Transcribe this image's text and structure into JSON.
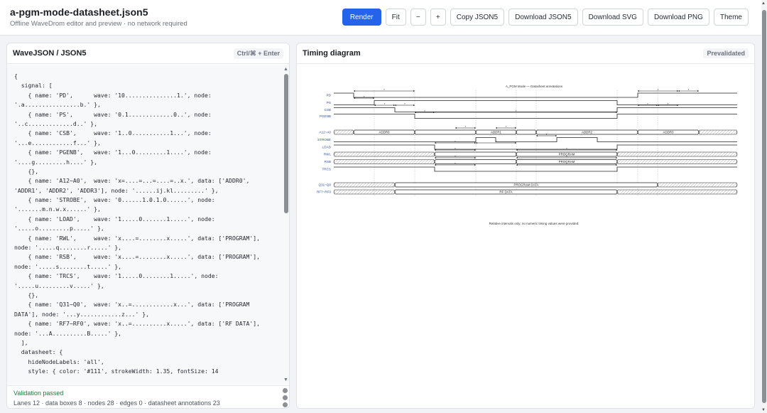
{
  "header": {
    "title": "a-pgm-mode-datasheet.json5",
    "subtitle": "Offline WaveDrom editor and preview · no network required"
  },
  "toolbar": {
    "render": "Render",
    "fit": "Fit",
    "zoom_out": "−",
    "zoom_in": "+",
    "copy_json5": "Copy JSON5",
    "download_json5": "Download JSON5",
    "download_svg": "Download SVG",
    "download_png": "Download PNG",
    "theme": "Theme"
  },
  "editor": {
    "title": "WaveJSON / JSON5",
    "shortcut": "Ctrl/⌘ + Enter",
    "code_lines": [
      "{",
      "  signal: [",
      "    { name: 'PD',      wave: '10...............1.', node:",
      "'.a................b.' },",
      "    { name: 'PS',      wave: '0.1.............0..', node:",
      "'..c.............d..' },",
      "    { name: 'CSB',     wave: '1..0...........1...', node:",
      "'...e............f...' },",
      "    { name: 'PGENB',   wave: '1...0.........1....', node:",
      "'....g.........h....' },",
      "    {},",
      "    { name: 'A12~A0',  wave: 'x=....=...=....=..x.', data: ['ADDR0',",
      "'ADDR1', 'ADDR2', 'ADDR3'], node: '......ij.kl.........' },",
      "    { name: 'STROBE',  wave: '0......1.0.1.0......', node:",
      "'.......m.n.w.x......' },",
      "    { name: 'LOAD',    wave: '1.....0.......1.....', node:",
      "'.....o.........p.....' },",
      "    { name: 'RWL',     wave: 'x....=........x.....', data: ['PROGRAM'],",
      "node: '.....q........r.....' },",
      "    { name: 'RSB',     wave: 'x....=........x.....', data: ['PROGRAM'],",
      "node: '.....s........t.....' },",
      "    { name: 'TRCS',    wave: '1.....0........1.....', node:",
      "'.....u.........v.....' },",
      "    {},",
      "    { name: 'Q31~Q0',  wave: 'x..=............x...', data: ['PROGRAM",
      "DATA'], node: '...y............z...' },",
      "    { name: 'RF7~RF0', wave: 'x..=..........x.....', data: ['RF DATA'],",
      "node: '...A..........B.....' },",
      "  ],",
      "  datasheet: {",
      "    hideNodeLabels: 'all',",
      "    style: { color: '#111', strokeWidth: 1.35, fontSize: 14"
    ]
  },
  "status": {
    "validation": "Validation passed",
    "stats": "Lanes 12 · data boxes 8 · nodes 28 · edges 0 · datasheet annotations 23"
  },
  "preview": {
    "title": "Timing diagram",
    "tag": "Prevalidated"
  },
  "diagram": {
    "title": "A_PGM Mode — Datasheet annotations",
    "note": "Relative intervals only; no numeric timing values were provided.",
    "signals": [
      "PD",
      "PS",
      "CSB",
      "PGENB",
      "A12~A0",
      "STROBE",
      "LOAD",
      "RWL",
      "RSB",
      "TRCS",
      "Q31~Q0",
      "RF7~RF0"
    ],
    "addr_labels": [
      "ADDR0",
      "ADDR1",
      "ADDR2",
      "ADDR3"
    ],
    "rwl_label": "PROGRAM",
    "rsb_label": "PROGRAM",
    "q_label": "PROGRAM DATA",
    "rf_label": "RF DATA",
    "colors": {
      "signal_name": "#2f4f9f",
      "wave": "#222222",
      "hatch": "#bdbdbd",
      "accent": "#2563eb"
    }
  }
}
